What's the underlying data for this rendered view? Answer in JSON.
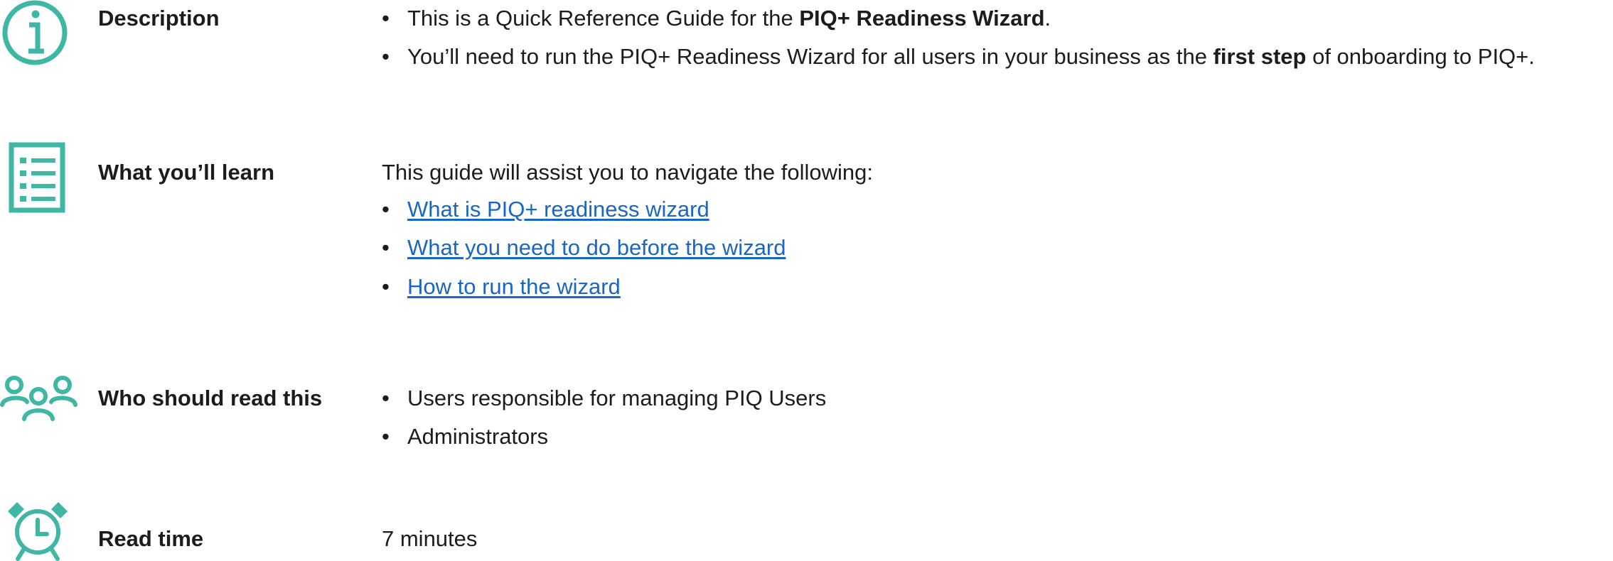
{
  "colors": {
    "accent": "#3fb7a4",
    "text": "#1c1c1c",
    "link": "#1a66c7"
  },
  "description": {
    "icon": "info-icon",
    "label": "Description",
    "bullet_1": {
      "pre": "This is a Quick Reference Guide for the ",
      "bold": "PIQ+ Readiness Wizard",
      "post": "."
    },
    "bullet_2": {
      "pre": "You’ll need to run the PIQ+ Readiness Wizard for all users in your business as the ",
      "bold": "first step",
      "post": " of onboarding to PIQ+."
    }
  },
  "learn": {
    "icon": "checklist-icon",
    "label": "What you’ll learn",
    "intro": "This guide will assist you to navigate the following:",
    "links": [
      "What is PIQ+ readiness wizard",
      "What you need to do before the wizard",
      "How to run the wizard"
    ]
  },
  "audience": {
    "icon": "users-group-icon",
    "label": "Who should read this",
    "items": [
      "Users responsible for managing PIQ Users",
      "Administrators"
    ]
  },
  "read_time": {
    "icon": "alarm-clock-icon",
    "label": "Read time",
    "value": "7 minutes"
  }
}
